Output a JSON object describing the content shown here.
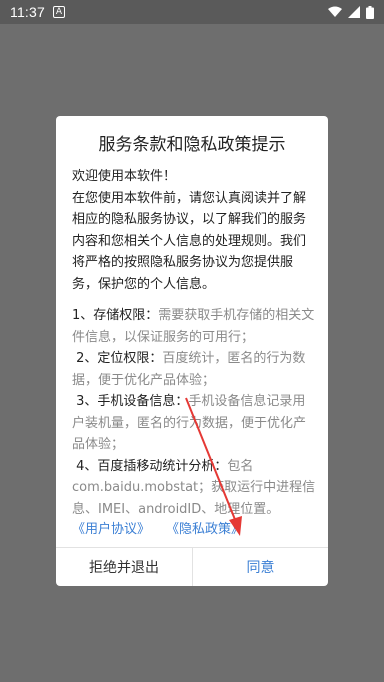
{
  "status_bar": {
    "time": "11:37",
    "notification_icon": "a-notification-icon",
    "icons": [
      "wifi-icon",
      "signal-icon",
      "battery-icon"
    ]
  },
  "dialog": {
    "title": "服务条款和隐私政策提示",
    "intro": [
      "欢迎使用本软件！",
      "在您使用本软件前，请您认真阅读并了解相应的隐私服务协议，以了解我们的服务内容和您相关个人信息的处理规则。我们将严格的按照隐私服务协议为您提供服务，保护您的个人信息。"
    ],
    "permissions": [
      {
        "head": "1、存储权限：",
        "text": "需要获取手机存储的相关文件信息，以保证服务的可用行；"
      },
      {
        "head": "2、定位权限：",
        "text": "百度统计，匿名的行为数据，便于优化产品体验；"
      },
      {
        "head": "3、手机设备信息：",
        "text": "手机设备信息记录用户装机量，匿名的行为数据，便于优化产品体验；"
      },
      {
        "head": "4、百度插移动统计分析：",
        "text": "包名com.baidu.mobstat；获取运行中进程信息、IMEI、androidID、地理位置。"
      }
    ],
    "links": {
      "user_agreement": "《用户协议》",
      "privacy_policy": "《隐私政策》"
    },
    "buttons": {
      "reject": "拒绝并退出",
      "agree": "同意"
    }
  },
  "colors": {
    "accent": "#3b7fd4",
    "annotation": "#e53935"
  }
}
